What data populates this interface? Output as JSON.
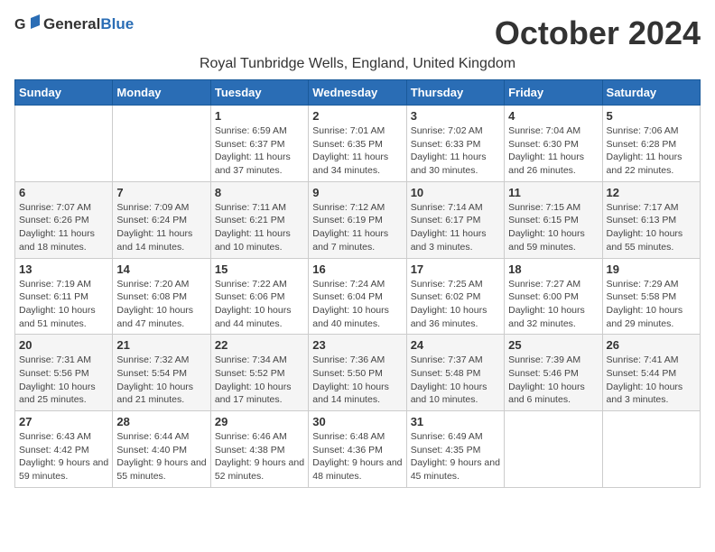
{
  "logo": {
    "general": "General",
    "blue": "Blue"
  },
  "title": "October 2024",
  "location": "Royal Tunbridge Wells, England, United Kingdom",
  "weekdays": [
    "Sunday",
    "Monday",
    "Tuesday",
    "Wednesday",
    "Thursday",
    "Friday",
    "Saturday"
  ],
  "weeks": [
    [
      {
        "day": "",
        "sunrise": "",
        "sunset": "",
        "daylight": ""
      },
      {
        "day": "",
        "sunrise": "",
        "sunset": "",
        "daylight": ""
      },
      {
        "day": "1",
        "sunrise": "Sunrise: 6:59 AM",
        "sunset": "Sunset: 6:37 PM",
        "daylight": "Daylight: 11 hours and 37 minutes."
      },
      {
        "day": "2",
        "sunrise": "Sunrise: 7:01 AM",
        "sunset": "Sunset: 6:35 PM",
        "daylight": "Daylight: 11 hours and 34 minutes."
      },
      {
        "day": "3",
        "sunrise": "Sunrise: 7:02 AM",
        "sunset": "Sunset: 6:33 PM",
        "daylight": "Daylight: 11 hours and 30 minutes."
      },
      {
        "day": "4",
        "sunrise": "Sunrise: 7:04 AM",
        "sunset": "Sunset: 6:30 PM",
        "daylight": "Daylight: 11 hours and 26 minutes."
      },
      {
        "day": "5",
        "sunrise": "Sunrise: 7:06 AM",
        "sunset": "Sunset: 6:28 PM",
        "daylight": "Daylight: 11 hours and 22 minutes."
      }
    ],
    [
      {
        "day": "6",
        "sunrise": "Sunrise: 7:07 AM",
        "sunset": "Sunset: 6:26 PM",
        "daylight": "Daylight: 11 hours and 18 minutes."
      },
      {
        "day": "7",
        "sunrise": "Sunrise: 7:09 AM",
        "sunset": "Sunset: 6:24 PM",
        "daylight": "Daylight: 11 hours and 14 minutes."
      },
      {
        "day": "8",
        "sunrise": "Sunrise: 7:11 AM",
        "sunset": "Sunset: 6:21 PM",
        "daylight": "Daylight: 11 hours and 10 minutes."
      },
      {
        "day": "9",
        "sunrise": "Sunrise: 7:12 AM",
        "sunset": "Sunset: 6:19 PM",
        "daylight": "Daylight: 11 hours and 7 minutes."
      },
      {
        "day": "10",
        "sunrise": "Sunrise: 7:14 AM",
        "sunset": "Sunset: 6:17 PM",
        "daylight": "Daylight: 11 hours and 3 minutes."
      },
      {
        "day": "11",
        "sunrise": "Sunrise: 7:15 AM",
        "sunset": "Sunset: 6:15 PM",
        "daylight": "Daylight: 10 hours and 59 minutes."
      },
      {
        "day": "12",
        "sunrise": "Sunrise: 7:17 AM",
        "sunset": "Sunset: 6:13 PM",
        "daylight": "Daylight: 10 hours and 55 minutes."
      }
    ],
    [
      {
        "day": "13",
        "sunrise": "Sunrise: 7:19 AM",
        "sunset": "Sunset: 6:11 PM",
        "daylight": "Daylight: 10 hours and 51 minutes."
      },
      {
        "day": "14",
        "sunrise": "Sunrise: 7:20 AM",
        "sunset": "Sunset: 6:08 PM",
        "daylight": "Daylight: 10 hours and 47 minutes."
      },
      {
        "day": "15",
        "sunrise": "Sunrise: 7:22 AM",
        "sunset": "Sunset: 6:06 PM",
        "daylight": "Daylight: 10 hours and 44 minutes."
      },
      {
        "day": "16",
        "sunrise": "Sunrise: 7:24 AM",
        "sunset": "Sunset: 6:04 PM",
        "daylight": "Daylight: 10 hours and 40 minutes."
      },
      {
        "day": "17",
        "sunrise": "Sunrise: 7:25 AM",
        "sunset": "Sunset: 6:02 PM",
        "daylight": "Daylight: 10 hours and 36 minutes."
      },
      {
        "day": "18",
        "sunrise": "Sunrise: 7:27 AM",
        "sunset": "Sunset: 6:00 PM",
        "daylight": "Daylight: 10 hours and 32 minutes."
      },
      {
        "day": "19",
        "sunrise": "Sunrise: 7:29 AM",
        "sunset": "Sunset: 5:58 PM",
        "daylight": "Daylight: 10 hours and 29 minutes."
      }
    ],
    [
      {
        "day": "20",
        "sunrise": "Sunrise: 7:31 AM",
        "sunset": "Sunset: 5:56 PM",
        "daylight": "Daylight: 10 hours and 25 minutes."
      },
      {
        "day": "21",
        "sunrise": "Sunrise: 7:32 AM",
        "sunset": "Sunset: 5:54 PM",
        "daylight": "Daylight: 10 hours and 21 minutes."
      },
      {
        "day": "22",
        "sunrise": "Sunrise: 7:34 AM",
        "sunset": "Sunset: 5:52 PM",
        "daylight": "Daylight: 10 hours and 17 minutes."
      },
      {
        "day": "23",
        "sunrise": "Sunrise: 7:36 AM",
        "sunset": "Sunset: 5:50 PM",
        "daylight": "Daylight: 10 hours and 14 minutes."
      },
      {
        "day": "24",
        "sunrise": "Sunrise: 7:37 AM",
        "sunset": "Sunset: 5:48 PM",
        "daylight": "Daylight: 10 hours and 10 minutes."
      },
      {
        "day": "25",
        "sunrise": "Sunrise: 7:39 AM",
        "sunset": "Sunset: 5:46 PM",
        "daylight": "Daylight: 10 hours and 6 minutes."
      },
      {
        "day": "26",
        "sunrise": "Sunrise: 7:41 AM",
        "sunset": "Sunset: 5:44 PM",
        "daylight": "Daylight: 10 hours and 3 minutes."
      }
    ],
    [
      {
        "day": "27",
        "sunrise": "Sunrise: 6:43 AM",
        "sunset": "Sunset: 4:42 PM",
        "daylight": "Daylight: 9 hours and 59 minutes."
      },
      {
        "day": "28",
        "sunrise": "Sunrise: 6:44 AM",
        "sunset": "Sunset: 4:40 PM",
        "daylight": "Daylight: 9 hours and 55 minutes."
      },
      {
        "day": "29",
        "sunrise": "Sunrise: 6:46 AM",
        "sunset": "Sunset: 4:38 PM",
        "daylight": "Daylight: 9 hours and 52 minutes."
      },
      {
        "day": "30",
        "sunrise": "Sunrise: 6:48 AM",
        "sunset": "Sunset: 4:36 PM",
        "daylight": "Daylight: 9 hours and 48 minutes."
      },
      {
        "day": "31",
        "sunrise": "Sunrise: 6:49 AM",
        "sunset": "Sunset: 4:35 PM",
        "daylight": "Daylight: 9 hours and 45 minutes."
      },
      {
        "day": "",
        "sunrise": "",
        "sunset": "",
        "daylight": ""
      },
      {
        "day": "",
        "sunrise": "",
        "sunset": "",
        "daylight": ""
      }
    ]
  ]
}
